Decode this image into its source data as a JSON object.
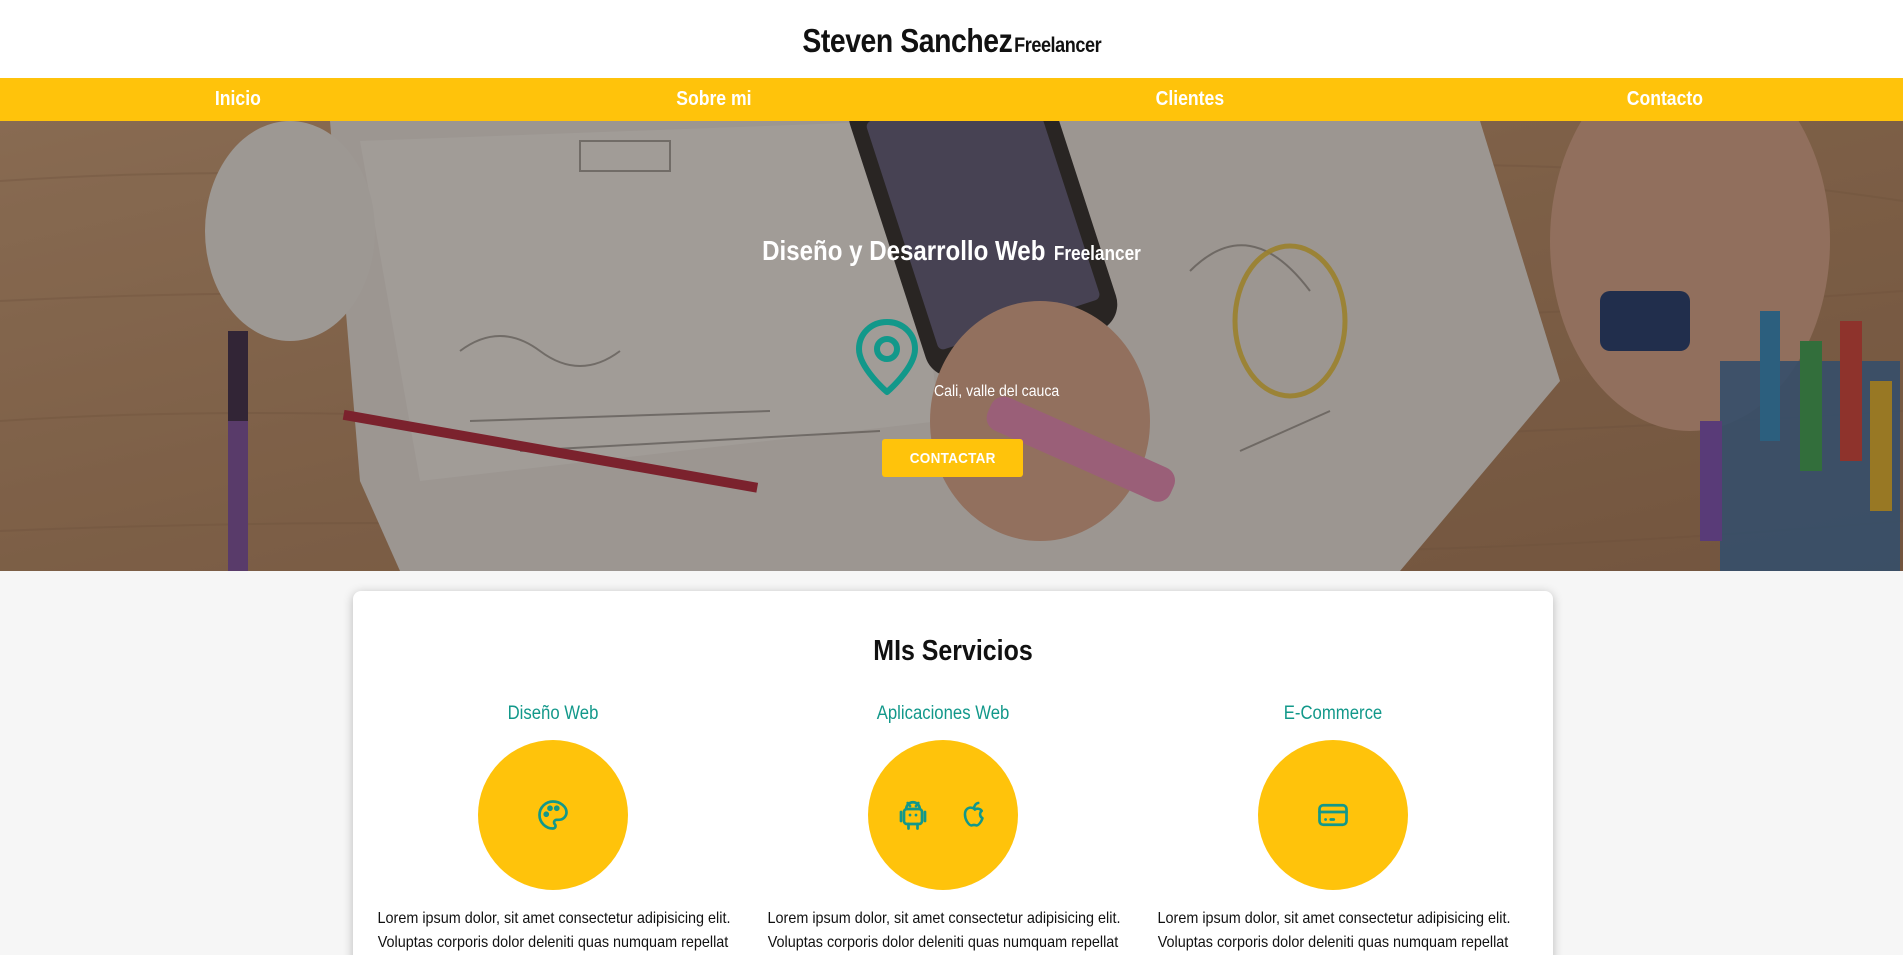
{
  "header": {
    "brand_name": "Steven Sanchez",
    "brand_tag": "Freelancer"
  },
  "nav": {
    "items": [
      {
        "label": "Inicio"
      },
      {
        "label": "Sobre mi"
      },
      {
        "label": "Clientes"
      },
      {
        "label": "Contacto"
      }
    ]
  },
  "hero": {
    "title": "Diseño y Desarrollo Web",
    "title_tag": "Freelancer",
    "location_icon": "map-pin-icon",
    "location": "Cali, valle del cauca",
    "cta_label": "CONTACTAR"
  },
  "services": {
    "title": "MIs Servicios",
    "items": [
      {
        "name": "Diseño Web",
        "icons": [
          "palette-icon"
        ],
        "text": "Lorem ipsum dolor, sit amet consectetur adipisicing elit.",
        "text2": "Voluptas corporis dolor deleniti quas numquam repellat"
      },
      {
        "name": "Aplicaciones Web",
        "icons": [
          "android-icon",
          "apple-icon"
        ],
        "text": "Lorem ipsum dolor, sit amet consectetur adipisicing elit.",
        "text2": "Voluptas corporis dolor deleniti quas numquam repellat"
      },
      {
        "name": "E-Commerce",
        "icons": [
          "credit-card-icon"
        ],
        "text": "Lorem ipsum dolor, sit amet consectetur adipisicing elit.",
        "text2": "Voluptas corporis dolor deleniti quas numquam repellat"
      }
    ]
  },
  "colors": {
    "accent": "#ffc30b",
    "teal": "#12988a",
    "text": "#111111"
  }
}
